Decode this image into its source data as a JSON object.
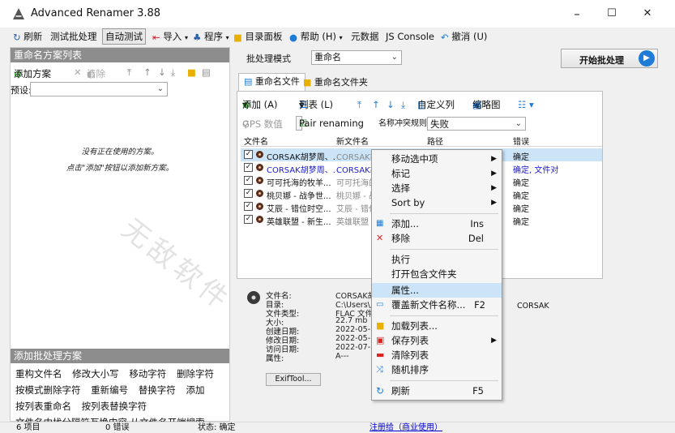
{
  "window": {
    "title": "Advanced Renamer 3.88",
    "minimize": "–",
    "maximize": "☐",
    "close": "✕"
  },
  "toolbar": {
    "refresh": "刷新",
    "test_batch": "测试批处理",
    "auto_test": "自动测试",
    "import": "导入",
    "program": "程序",
    "dir_panel": "目录面板",
    "help": "帮助 (H)",
    "metadata": "元数据",
    "js_console": "JS Console",
    "undo": "撤消 (U)"
  },
  "left": {
    "header_methods": "重命名方案列表",
    "add_method": "添加方案",
    "clear": "清除",
    "preset_label": "预设:",
    "empty_line1": "没有正在使用的方案。",
    "empty_line2": "点击\"添加\"按钮以添加新方案。",
    "header_add": "添加批处理方案",
    "methods_row1": [
      "重构文件名",
      "修改大小写",
      "移动字符",
      "删除字符"
    ],
    "methods_row2": [
      "按模式删除字符",
      "重新编号",
      "替换字符",
      "添加"
    ],
    "methods_row3": [
      "按列表重命名",
      "按列表替换字符"
    ],
    "methods_row4": "文件名中找分隔符互换内容  从文件名开端搜索"
  },
  "batch": {
    "mode_label": "批处理模式",
    "mode_value": "重命名",
    "start": "开始批处理"
  },
  "tabs": {
    "rename_files": "重命名文件",
    "rename_folders": "重命名文件夹"
  },
  "list_toolbar": {
    "add": "添加 (A)",
    "list": "列表 (L)",
    "custom_columns": "自定义列",
    "thumbnails": "缩略图",
    "gps": "GPS 数值",
    "pair_renaming": "Pair renaming",
    "conflict_label": "名称冲突规则:",
    "conflict_value": "失败"
  },
  "grid": {
    "headers": [
      "文件名",
      "新文件名",
      "路径",
      "错误"
    ],
    "rows": [
      {
        "name": "CORSAK胡梦周、...",
        "new": "CORSAK胡梦",
        "error": "确定",
        "blue": false
      },
      {
        "name": "CORSAK胡梦周、...",
        "new": "CORSAK胡梦",
        "error": "确定, 文件对",
        "blue": true
      },
      {
        "name": "可可托海的牧羊...",
        "new": "可可托海的",
        "error": "确定",
        "blue": false
      },
      {
        "name": "桃贝娜 - 战争世...",
        "new": "桃贝娜 - 战",
        "error": "确定",
        "blue": false
      },
      {
        "name": "艾辰 - 错位时空...",
        "new": "艾辰 - 错位",
        "error": "确定",
        "blue": false
      },
      {
        "name": "英雄联盟 - 新生...",
        "new": "英雄联盟 - 新",
        "error": "确定",
        "blue": false
      }
    ]
  },
  "info": {
    "labels": [
      "文件名:",
      "目录:",
      "文件类型:",
      "大小:",
      "创建日期:",
      "修改日期:",
      "访问日期:",
      "属性:"
    ],
    "values": [
      "CORSAK胡梦",
      "C:\\Users\\风",
      "FLAC 文件",
      "22.7 mb",
      "2022-05-10",
      "2022-05-10",
      "2022-07-15",
      "A---"
    ],
    "artist": "CORSAK",
    "exiftool": "ExifTool..."
  },
  "context_menu": {
    "move_selected": "移动选中项",
    "mark": "标记",
    "select": "选择",
    "sort_by": "Sort by",
    "add": "添加...",
    "add_shortcut": "Ins",
    "remove": "移除",
    "remove_shortcut": "Del",
    "execute": "执行",
    "open_folder": "打开包含文件夹",
    "properties": "属性...",
    "overwrite_name": "覆盖新文件名称...",
    "overwrite_shortcut": "F2",
    "load_list": "加载列表...",
    "save_list": "保存列表",
    "clear_list": "清除列表",
    "random_sort": "随机排序",
    "refresh": "刷新",
    "refresh_shortcut": "F5"
  },
  "status": {
    "items": "6 项目",
    "errors": "0 错误",
    "state": "状态: 确定",
    "registered": "注册给（商业使用）"
  },
  "watermark": "无敌软件",
  "colors": {
    "accent_blue": "#1e7bd6",
    "header_gray": "#8d8d8d",
    "selection": "#cce4f7",
    "link_blue": "#0000cc"
  }
}
